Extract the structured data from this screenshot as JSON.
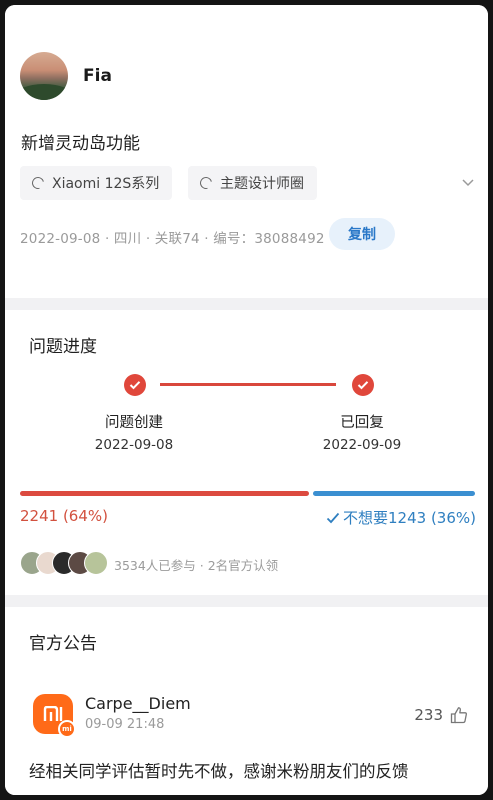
{
  "issue": {
    "username": "Fia",
    "title": "新增灵动岛功能",
    "tags": [
      {
        "label": "Xiaomi 12S系列",
        "icon": "topic-icon"
      },
      {
        "label": "主题设计师圈",
        "icon": "topic-icon"
      }
    ],
    "meta": "2022-09-08 · 四川 · 关联74 · 编号：38088492",
    "copy_label": "复制"
  },
  "progress": {
    "title": "问题进度",
    "steps": [
      {
        "label": "问题创建",
        "date": "2022-09-08",
        "done": true
      },
      {
        "label": "已回复",
        "date": "2022-09-09",
        "done": true
      }
    ],
    "vote": {
      "left_text": "2241 (64%)",
      "left_fraction": 0.64,
      "right_text": "不想要1243 (36%)",
      "right_fraction": 0.36,
      "left_color": "#dc4a3f",
      "right_color": "#3b8fd1"
    },
    "participants": "3534人已参与 · 2名官方认领"
  },
  "notice": {
    "title": "官方公告",
    "author": "Carpe__Diem",
    "time": "09-09 21:48",
    "likes": "233",
    "text": "经相关同学评估暂时先不做，感谢米粉朋友们的反馈",
    "logo_color": "#ff6a18"
  }
}
